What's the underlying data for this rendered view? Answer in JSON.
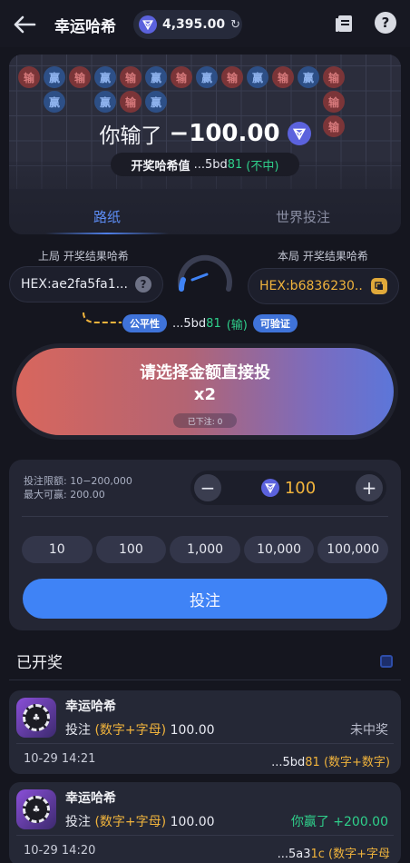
{
  "header": {
    "title": "幸运哈希",
    "balance": "4,395.00"
  },
  "road": {
    "row1": [
      "输",
      "赢",
      "输",
      "赢",
      "输",
      "赢",
      "输",
      "赢",
      "输",
      "赢",
      "输",
      "赢",
      "输"
    ],
    "row2": [
      "",
      "赢",
      "",
      "赢",
      "输",
      "赢",
      "",
      "",
      "",
      "",
      "",
      "",
      "输"
    ],
    "row3": [
      "",
      "",
      "",
      "",
      "",
      "",
      "",
      "",
      "",
      "",
      "",
      "",
      "输"
    ],
    "result_text": "你输了",
    "result_amount": "−100.00",
    "hash_label": "开奖哈希值",
    "hash_prefix": "...5bd",
    "hash_suffix": "81",
    "hash_status": "(不中)",
    "tabs": [
      "路纸",
      "世界投注"
    ]
  },
  "hashes": {
    "prev_label": "上局 开奖结果哈希",
    "prev_value": "HEX:ae2fa5fa1...",
    "curr_label": "本局 开奖结果哈希",
    "curr_value": "HEX:b6836230...",
    "fair_badge": "公平性",
    "fair_prefix": "...5bd",
    "fair_suffix": "81",
    "fair_result": "(输)",
    "verify_badge": "可验证"
  },
  "bet_button": {
    "line1": "请选择金额直接投",
    "line2": "x2",
    "placed": "已下注: 0"
  },
  "bet_panel": {
    "limit_line": "投注限额: 10−200,000",
    "max_win_line": "最大可赢: 200.00",
    "amount": "100",
    "chips": [
      "10",
      "100",
      "1,000",
      "10,000",
      "100,000"
    ],
    "submit": "投注"
  },
  "opened": {
    "title": "已开奖",
    "records": [
      {
        "name": "幸运哈希",
        "bet_label": "投注",
        "bet_type": "(数字+字母)",
        "bet_amount": "100.00",
        "status": "未中奖",
        "status_color": "#b9bccb",
        "time": "10-29 14:21",
        "hash_prefix": "...5bd",
        "hash_suffix": "81",
        "hash_type": "(数字+数字)"
      },
      {
        "name": "幸运哈希",
        "bet_label": "投注",
        "bet_type": "(数字+字母)",
        "bet_amount": "100.00",
        "status": "你赢了 +200.00",
        "status_color": "#2fd08b",
        "time": "10-29 14:20",
        "hash_prefix": "...5a3",
        "hash_suffix": "1c",
        "hash_type": "(数字+字母"
      }
    ]
  },
  "colors": {
    "accent_blue": "#3f83f6",
    "gold": "#f0b33c",
    "green": "#2fd08b",
    "lose_red": "#7b3538",
    "win_blue": "#2d4f86"
  }
}
